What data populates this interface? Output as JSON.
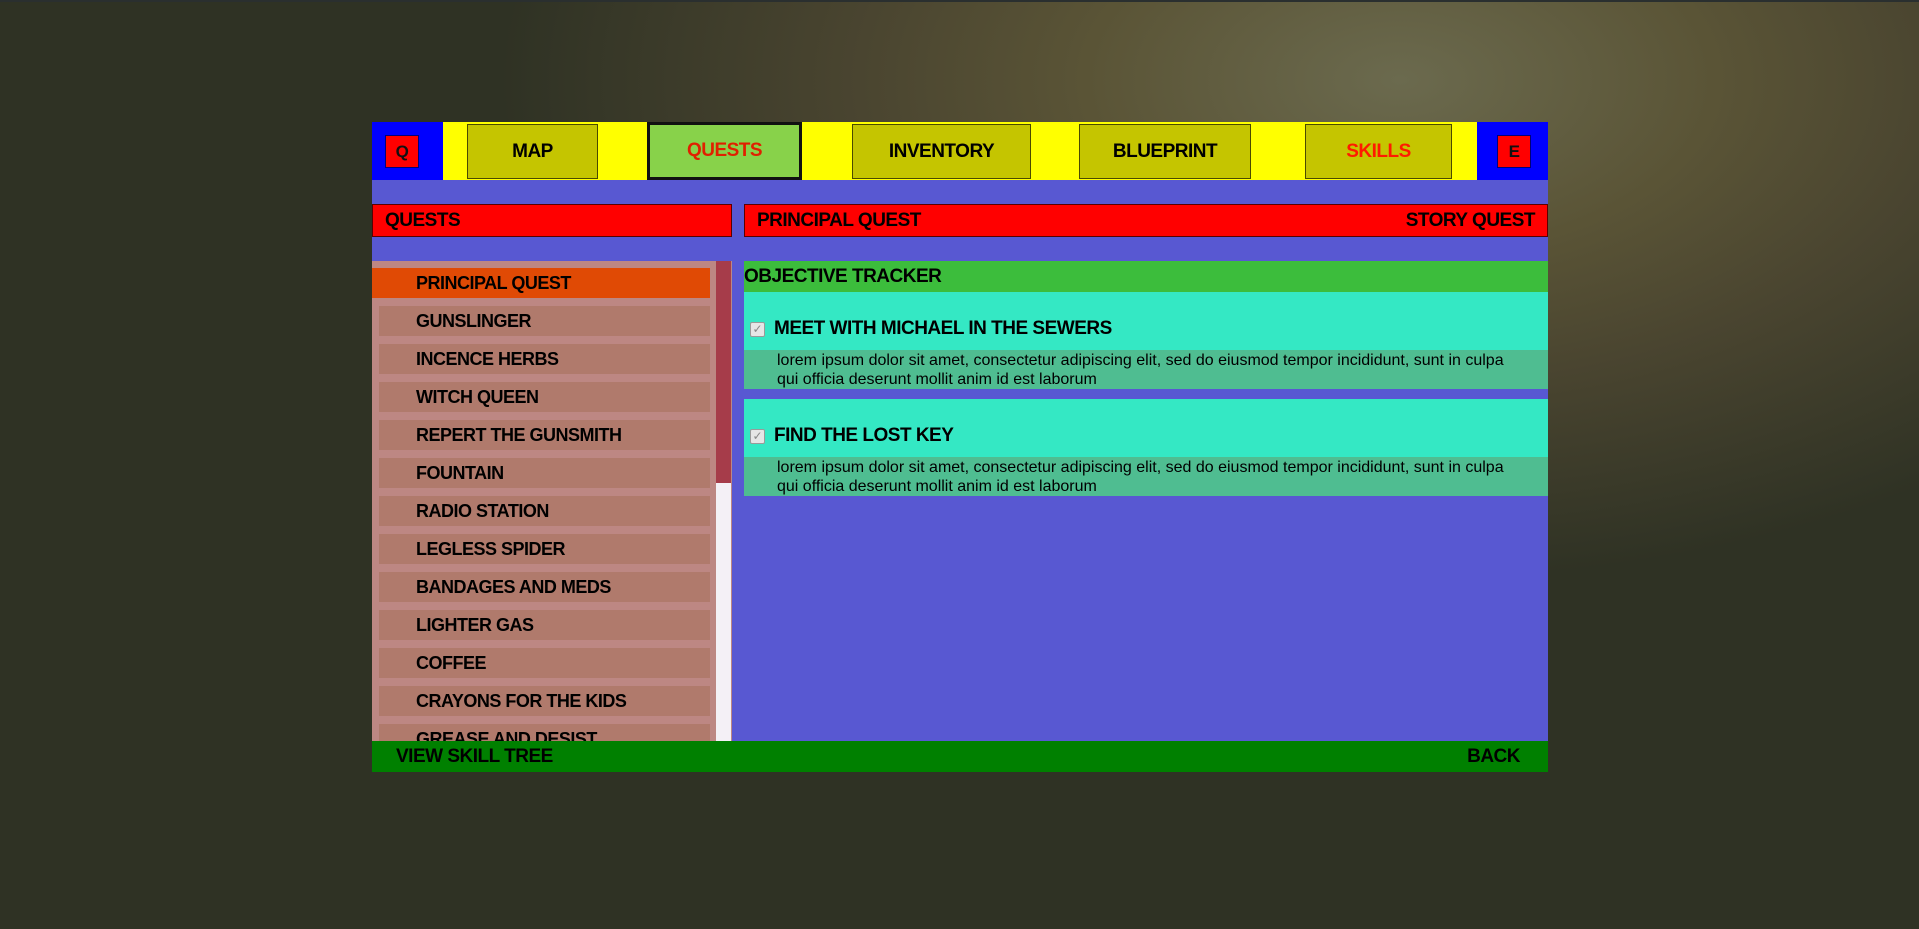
{
  "nav": {
    "left_key": "Q",
    "right_key": "E",
    "tabs": [
      {
        "label": "MAP"
      },
      {
        "label": "QUESTS"
      },
      {
        "label": "INVENTORY"
      },
      {
        "label": "BLUEPRINT"
      },
      {
        "label": "SKILLS"
      }
    ],
    "active_tab": "QUESTS"
  },
  "quests_header": "QUESTS",
  "detail_header": {
    "title": "PRINCIPAL QUEST",
    "type": "STORY QUEST"
  },
  "quest_list": [
    "PRINCIPAL QUEST",
    "GUNSLINGER",
    "INCENCE HERBS",
    "WITCH QUEEN",
    "REPERT THE GUNSMITH",
    "FOUNTAIN",
    "RADIO STATION",
    "LEGLESS SPIDER",
    "BANDAGES AND MEDS",
    "LIGHTER GAS",
    "COFFEE",
    "CRAYONS FOR THE KIDS",
    "GREASE AND DESIST"
  ],
  "selected_quest": "PRINCIPAL QUEST",
  "tracker": {
    "title": "OBJECTIVE TRACKER",
    "objectives": [
      {
        "title": "MEET WITH MICHAEL IN THE SEWERS",
        "checked": true,
        "desc_line1": "lorem ipsum dolor sit amet, consectetur adipiscing elit, sed do eiusmod tempor incididunt, sunt in culpa",
        "desc_line2": "qui officia deserunt mollit anim id est laborum"
      },
      {
        "title": "FIND THE LOST KEY",
        "checked": true,
        "desc_line1": "lorem ipsum dolor sit amet, consectetur adipiscing elit, sed do eiusmod tempor incididunt, sunt in culpa",
        "desc_line2": "qui officia deserunt mollit anim id est laborum"
      }
    ]
  },
  "footer": {
    "left": "VIEW SKILL TREE",
    "right": "BACK"
  },
  "colors": {
    "panel": "#5858d2",
    "nav_bar": "#ffff00",
    "key_block": "#0000ff",
    "header_red": "#ff0000",
    "selected_item": "#e04a05",
    "tracker_green": "#3cbd3c",
    "objective_teal": "#34e8c4",
    "footer_green": "#008000"
  },
  "icons": [
    "checkbox-checked-icon"
  ]
}
